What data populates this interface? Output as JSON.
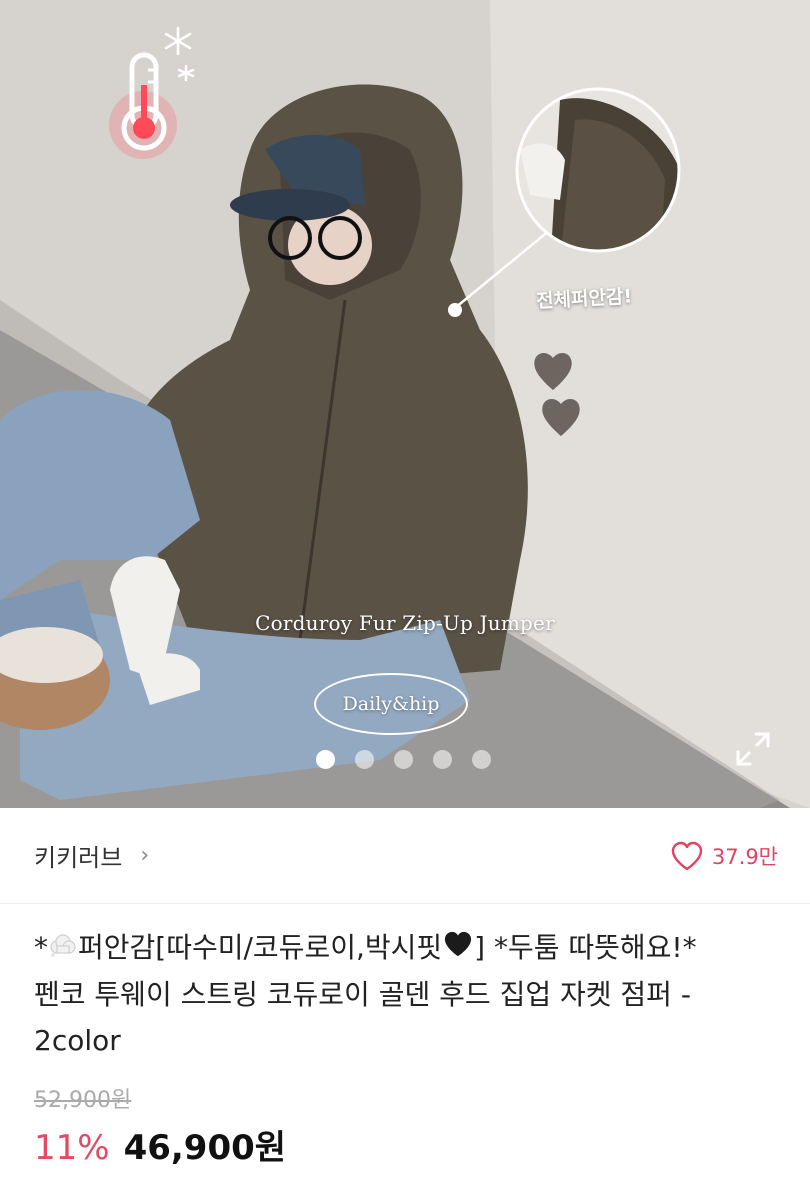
{
  "hero": {
    "product_caption": "Corduroy Fur Zip-Up Jumper",
    "style_badge": "Daily&hip",
    "lining_label": "전체퍼안감!",
    "slide_count": 5,
    "active_slide": 1
  },
  "store": {
    "name": "키키러브",
    "chevron": "›",
    "like_count": "37.9만"
  },
  "product": {
    "title_prefix": "*",
    "title_line1_rest": "퍼안감[따수미/코듀로이,박시핏",
    "title_line1_end": "] *두툼 따뜻해요!*",
    "title_line2": "펜코 투웨이 스트링 코듀로이 골덴 후드 집업 자켓 점퍼 -",
    "title_line3": "2color",
    "original_price": "52,900원",
    "discount": "11%",
    "sale_price": "46,900원"
  },
  "colors": {
    "accent": "#e04462",
    "discount": "#e24a66"
  },
  "icons": {
    "thermometer": "thermometer-icon",
    "snowflake": "snowflake-icon",
    "heart": "heart-outline-icon",
    "expand": "expand-icon",
    "cloud_emoji": "cloud-icon",
    "black_heart_emoji": "black-heart-icon"
  }
}
